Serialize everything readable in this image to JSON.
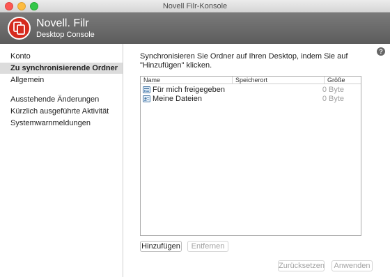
{
  "window": {
    "title": "Novell Filr-Konsole"
  },
  "header": {
    "brand": "Novell. Filr",
    "subtitle": "Desktop Console"
  },
  "sidebar": {
    "items": [
      {
        "label": "Konto"
      },
      {
        "label": "Zu synchronisierende Ordner"
      },
      {
        "label": "Allgemein"
      },
      {
        "label": "Ausstehende Änderungen"
      },
      {
        "label": "Kürzlich ausgeführte Aktivität"
      },
      {
        "label": "Systemwarnmeldungen"
      }
    ]
  },
  "main": {
    "instruction": "Synchronisieren Sie Ordner auf Ihren Desktop, indem Sie auf \"Hinzufügen\" klicken.",
    "table": {
      "columns": [
        "Name",
        "Speicherort",
        "Größe"
      ],
      "rows": [
        {
          "name": "Für mich freigegeben",
          "location": "",
          "size": "0 Byte",
          "icon": "shared-folder-icon"
        },
        {
          "name": "Meine Dateien",
          "location": "",
          "size": "0 Byte",
          "icon": "my-files-icon"
        }
      ]
    },
    "buttons": {
      "add": "Hinzufügen",
      "remove": "Entfernen"
    }
  },
  "footer": {
    "reset": "Zurücksetzen",
    "apply": "Anwenden"
  },
  "help": {
    "label": "?"
  },
  "colors": {
    "brand_red": "#d52b1e",
    "header_gray": "#6b6b6b",
    "selection": "#dcdcdc"
  }
}
